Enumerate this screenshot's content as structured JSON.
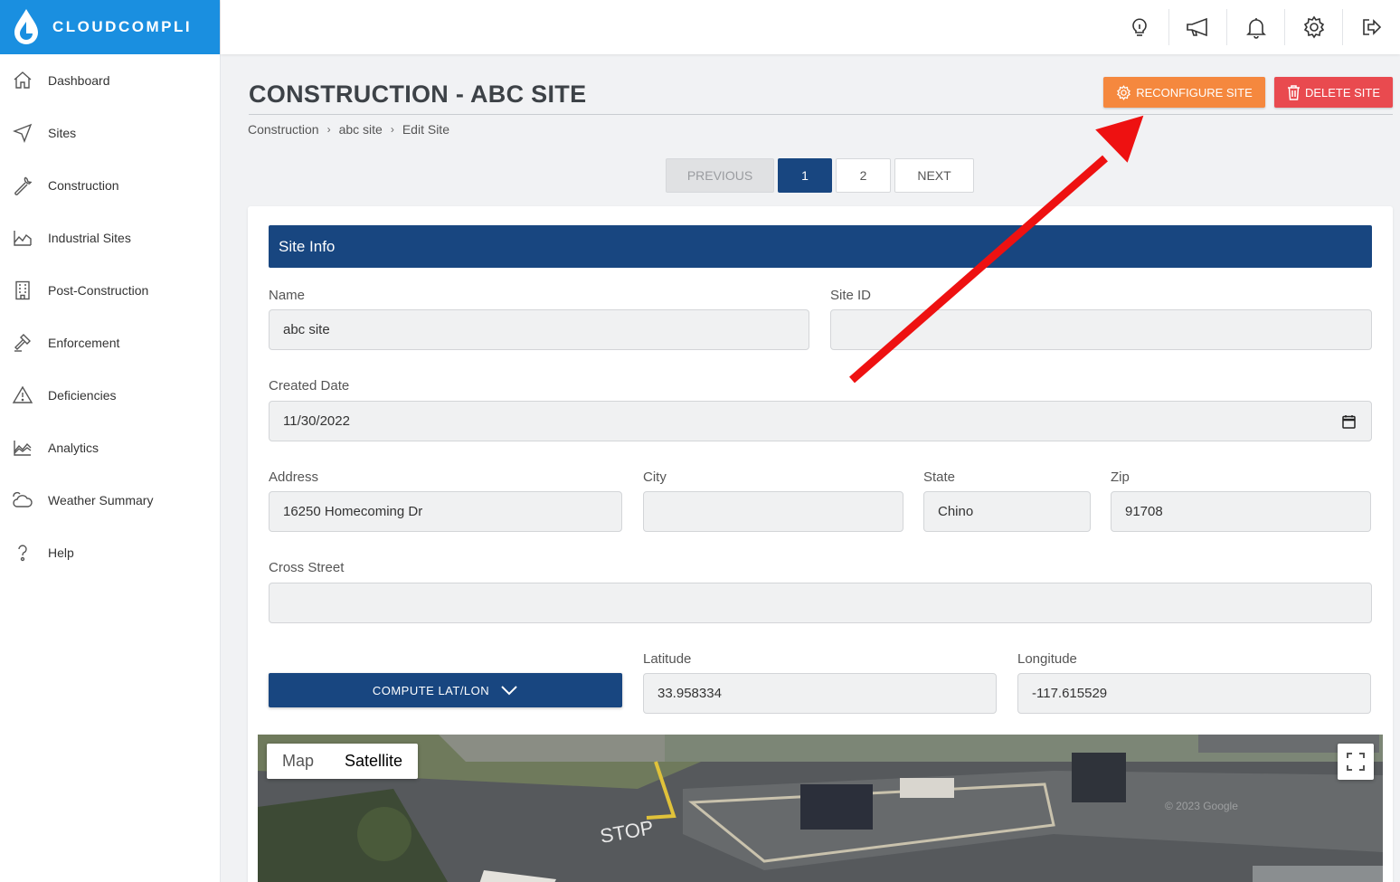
{
  "app": {
    "brand": "CLOUDCOMPLI",
    "accent": "#1a8fe0",
    "primary": "#184680"
  },
  "sidebar": {
    "items": [
      {
        "label": "Dashboard",
        "icon": "home-icon"
      },
      {
        "label": "Sites",
        "icon": "navigation-arrow-icon"
      },
      {
        "label": "Construction",
        "icon": "wrench-icon"
      },
      {
        "label": "Industrial Sites",
        "icon": "factory-icon"
      },
      {
        "label": "Post-Construction",
        "icon": "building-icon"
      },
      {
        "label": "Enforcement",
        "icon": "gavel-icon"
      },
      {
        "label": "Deficiencies",
        "icon": "warning-icon"
      },
      {
        "label": "Analytics",
        "icon": "area-chart-icon"
      },
      {
        "label": "Weather Summary",
        "icon": "cloud-sun-icon"
      },
      {
        "label": "Help",
        "icon": "question-icon"
      }
    ]
  },
  "topbar": {
    "icons": [
      "lightbulb-icon",
      "megaphone-icon",
      "bell-icon",
      "gear-icon",
      "logout-icon"
    ]
  },
  "page": {
    "title": "CONSTRUCTION - ABC SITE",
    "breadcrumb": [
      "Construction",
      "abc site",
      "Edit Site"
    ],
    "reconfigure_label": "RECONFIGURE SITE",
    "delete_label": "DELETE SITE",
    "reconfigure_color": "#f5883e",
    "delete_color": "#e94a4f"
  },
  "pagination": {
    "previous": "PREVIOUS",
    "pages": [
      "1",
      "2"
    ],
    "current": "1",
    "next": "NEXT"
  },
  "form": {
    "section_title": "Site Info",
    "name_label": "Name",
    "name_value": "abc site",
    "site_id_label": "Site ID",
    "site_id_value": "",
    "created_date_label": "Created Date",
    "created_date_value": "11/30/2022",
    "address_label": "Address",
    "address_value": "16250 Homecoming Dr",
    "city_label": "City",
    "city_value": "",
    "state_label": "State",
    "state_value": "Chino",
    "zip_label": "Zip",
    "zip_value": "91708",
    "cross_street_label": "Cross Street",
    "cross_street_value": "",
    "compute_label": "COMPUTE LAT/LON",
    "latitude_label": "Latitude",
    "latitude_value": "33.958334",
    "longitude_label": "Longitude",
    "longitude_value": "-117.615529"
  },
  "map": {
    "map_option": "Map",
    "satellite_option": "Satellite",
    "selected": "Satellite",
    "attribution": "© 2023 Google"
  }
}
